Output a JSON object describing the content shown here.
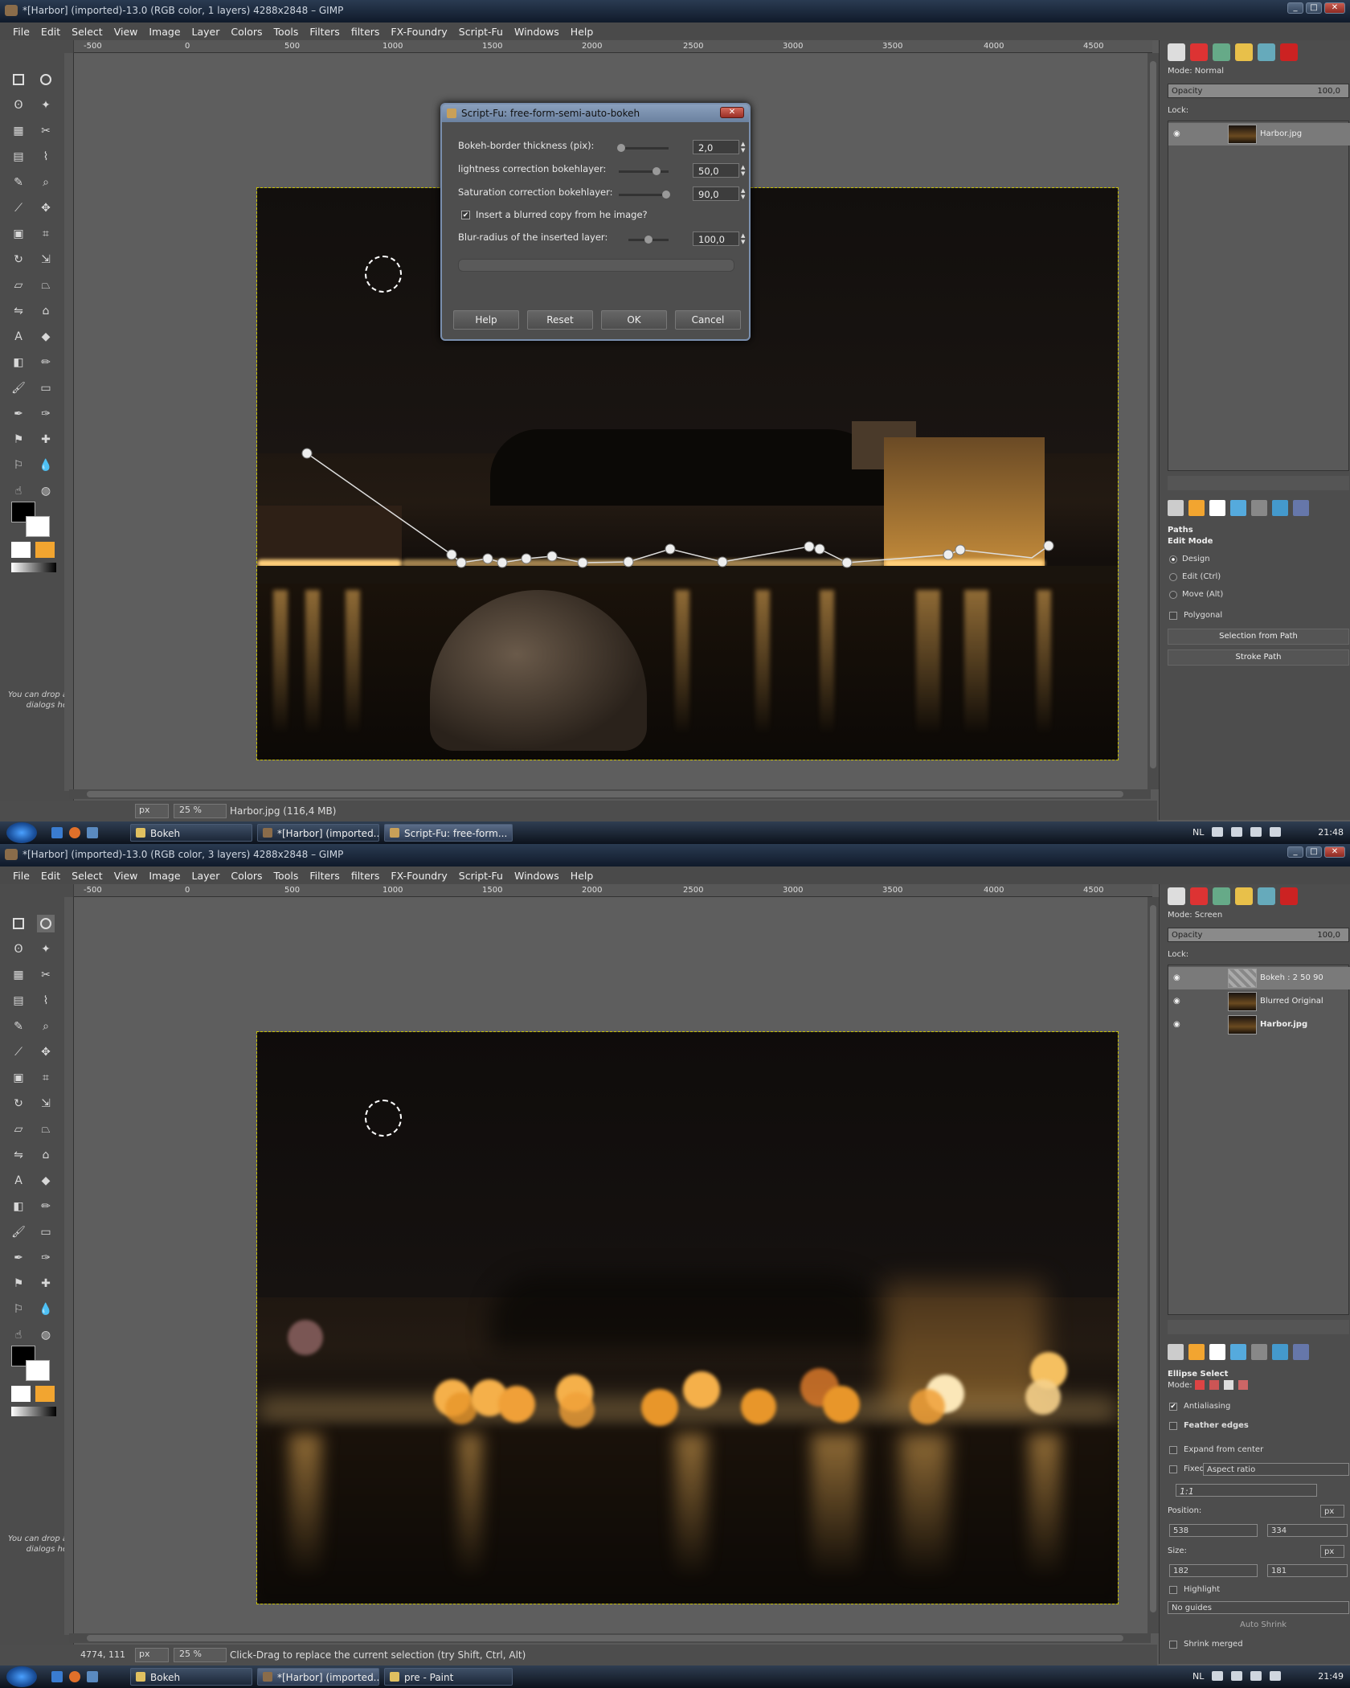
{
  "screens": [
    {
      "title": "*[Harbor] (imported)-13.0 (RGB color, 1 layers) 4288x2848 – GIMP",
      "menu": [
        "File",
        "Edit",
        "Select",
        "View",
        "Image",
        "Layer",
        "Colors",
        "Tools",
        "Filters",
        "filters",
        "FX-Foundry",
        "Script-Fu",
        "Windows",
        "Help"
      ],
      "ruler_ticks": [
        "-500",
        "0",
        "500",
        "1000",
        "1500",
        "2000",
        "2500",
        "3000",
        "3500",
        "4000",
        "4500"
      ],
      "status": {
        "unit": "px",
        "zoom": "25 %",
        "text": "Harbor.jpg (116,4 MB)",
        "coords": ""
      },
      "mode": "Mode: Normal",
      "opacity_label": "Opacity",
      "opacity_value": "100,0",
      "lock_label": "Lock:",
      "layers": [
        {
          "name": "Harbor.jpg",
          "selected": true,
          "checker": false
        }
      ],
      "drop_hint": "You can drop a dialogs he",
      "taskbar": {
        "tasks": [
          "Bokeh",
          "*[Harbor] (imported...",
          "Script-Fu: free-form..."
        ],
        "lang": "NL",
        "time": "21:48"
      },
      "options": {
        "title": "Paths",
        "subtitle": "Edit Mode",
        "radios": [
          "Design",
          "Edit (Ctrl)",
          "Move (Alt)"
        ],
        "polygonal": "Polygonal",
        "buttons": [
          "Selection from Path",
          "Stroke Path"
        ]
      }
    },
    {
      "title": "*[Harbor] (imported)-13.0 (RGB color, 3 layers) 4288x2848 – GIMP",
      "menu": [
        "File",
        "Edit",
        "Select",
        "View",
        "Image",
        "Layer",
        "Colors",
        "Tools",
        "Filters",
        "filters",
        "FX-Foundry",
        "Script-Fu",
        "Windows",
        "Help"
      ],
      "ruler_ticks": [
        "-500",
        "0",
        "500",
        "1000",
        "1500",
        "2000",
        "2500",
        "3000",
        "3500",
        "4000",
        "4500"
      ],
      "status": {
        "unit": "px",
        "zoom": "25 %",
        "text": "Click-Drag to replace the current selection (try Shift, Ctrl, Alt)",
        "coords": "4774, 111"
      },
      "mode": "Mode: Screen",
      "opacity_label": "Opacity",
      "opacity_value": "100,0",
      "lock_label": "Lock:",
      "layers": [
        {
          "name": "Bokeh : 2 50 90",
          "selected": true,
          "checker": true
        },
        {
          "name": "Blurred Original",
          "selected": false,
          "checker": false
        },
        {
          "name": "Harbor.jpg",
          "selected": false,
          "checker": false
        }
      ],
      "drop_hint": "You can drop a dialogs he",
      "taskbar": {
        "tasks": [
          "Bokeh",
          "*[Harbor] (imported...",
          "pre - Paint"
        ],
        "lang": "NL",
        "time": "21:49"
      },
      "options": {
        "title": "Ellipse Select",
        "mode_label": "Mode:",
        "antialiasing": "Antialiasing",
        "feather": "Feather edges",
        "expand": "Expand from center",
        "fixed": "Fixed:",
        "fixed_value": "Aspect ratio",
        "ratio": "1:1",
        "position_label": "Position:",
        "pos_unit": "px",
        "pos_x": "538",
        "pos_y": "334",
        "size_label": "Size:",
        "size_unit": "px",
        "size_w": "182",
        "size_h": "181",
        "highlight": "Highlight",
        "guides": "No guides",
        "auto_shrink": "Auto Shrink",
        "shrink_merged": "Shrink merged"
      }
    }
  ],
  "dialog": {
    "title": "Script-Fu: free-form-semi-auto-bokeh",
    "fields": [
      {
        "label": "Bokeh-border thickness (pix):",
        "value": "2,0",
        "level": 0.05
      },
      {
        "label": "lightness correction bokehlayer:",
        "value": "50,0",
        "level": 0.75
      },
      {
        "label": "Saturation correction bokehlayer:",
        "value": "90,0",
        "level": 0.95
      },
      {
        "label": "Blur-radius of the inserted layer:",
        "value": "100,0",
        "level": 0.5
      }
    ],
    "checkbox": "Insert a blurred copy from he image?",
    "checked": true,
    "buttons": [
      "Help",
      "Reset",
      "OK",
      "Cancel"
    ]
  },
  "colors": {
    "accent": "#f2a530",
    "bokeh": "#f5b04a",
    "bokeh_pink": "#a07070"
  }
}
